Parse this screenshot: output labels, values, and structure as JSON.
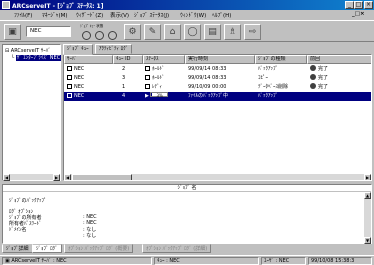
{
  "window": {
    "title": "ARCserveIT - [ｼﾞｮﾌﾞ ｽﾃｰﾀｽ: 1]",
    "controls": [
      "_",
      "□",
      "×"
    ]
  },
  "menu": [
    "ﾌｧｲﾙ(F)",
    "ﾏﾈｰｼﾞｬ(M)",
    "ｳｨｻﾞｰﾄﾞ(Z)",
    "表示(V)",
    "ｼﾞｮﾌﾞ ｽﾃｰﾀｽ(J)",
    "ｳｨﾝﾄﾞｳ(W)",
    "ﾍﾙﾌﾟ(H)"
  ],
  "toolbar": {
    "server_value": "NEC",
    "job_queue_caption": "ｼﾞｮﾌﾞ ｷｭｰ 状態",
    "icons": [
      "server-icon",
      "filter-icon",
      "delete-icon",
      "properties-icon",
      "stop-icon",
      "print-icon",
      "monitor-icon",
      "help-icon"
    ]
  },
  "tree": {
    "root": "ARCserveIT ｻｰﾊﾞ",
    "child": "ｻﾞ ｴﾝﾀｰﾌﾟﾗｲｽﾞ NEC"
  },
  "tabs": [
    "ｼﾞｮﾌﾞ ｷｭｰ",
    "ｱｸﾃｨﾋﾞﾃｨ ﾛｸﾞ"
  ],
  "table": {
    "columns": [
      "ｻｰﾊﾞ",
      "ｷｭｰ ID",
      "ｽﾃｰﾀｽ",
      "実行時刻",
      "ｼﾞｮﾌﾞの種類",
      "前回"
    ],
    "rows": [
      {
        "server": "NEC",
        "queue_id": "2",
        "status": "ﾎｰﾙﾄﾞ",
        "time": "99/09/14  08:33",
        "type": "ﾊﾞｯｸｱｯﾌﾟ",
        "last": "完了",
        "selected": false
      },
      {
        "server": "NEC",
        "queue_id": "3",
        "status": "ﾎｰﾙﾄﾞ",
        "time": "99/09/14  08:33",
        "type": "ｺﾋﾟｰ",
        "last": "完了",
        "selected": false
      },
      {
        "server": "NEC",
        "queue_id": "1",
        "status": "ﾚﾃﾞｨ",
        "time": "99/10/09  00:00",
        "type": "ﾃﾞｰﾀﾍﾞｰｽ削除",
        "last": "完了",
        "selected": false
      },
      {
        "server": "NEC",
        "queue_id": "4",
        "status": "",
        "progress_label": "3%",
        "progress": 0.03,
        "time": "ﾌｧｲﾙのﾊﾞｯｸｱｯﾌﾟ中",
        "type": "ﾊﾞｯｸｱｯﾌﾟ",
        "last": "",
        "selected": true
      }
    ]
  },
  "detail": {
    "title": "ｼﾞｮﾌﾞ 名",
    "lines": [
      {
        "label": "ｼﾞｮﾌﾞのﾊﾞｯｸｱｯﾌﾟ",
        "value": ""
      },
      {
        "label": "ﾛｸﾞ ｵﾌﾟｼｮﾝ",
        "value": ""
      },
      {
        "label": "ｼﾞｮﾌﾞの所有者",
        "value": ": NEC"
      },
      {
        "label": "所有者ﾊﾟｽﾜｰﾄﾞ",
        "value": ": NEC"
      },
      {
        "label": "ﾄﾞﾒｲﾝ名",
        "value": ": なし"
      },
      {
        "label": "",
        "value": ": なし"
      }
    ]
  },
  "bottom_tabs": [
    {
      "label": "ｼﾞｮﾌﾞ詳細",
      "active": false,
      "disabled": false
    },
    {
      "label": "ｼﾞｮﾌﾞ ﾛｸﾞ",
      "active": true,
      "disabled": false
    },
    {
      "label": "ｵﾌﾟｼｮﾝ ﾊﾞｯｸｱｯﾌﾟ ﾛｸﾞ (概要)",
      "active": false,
      "disabled": true
    },
    {
      "label": "ｵﾌﾟｼｮﾝ ﾊﾞｯｸｱｯﾌﾟ ﾛｸﾞ (詳細)",
      "active": false,
      "disabled": true
    }
  ],
  "status": {
    "server": "ARCserveIT ｻｰﾊﾞ : NEC",
    "queue": "ｷｭｰ : NEC",
    "user": "ﾕｰｻﾞ : NEC",
    "datetime": "99/10/08  15:38:3"
  }
}
